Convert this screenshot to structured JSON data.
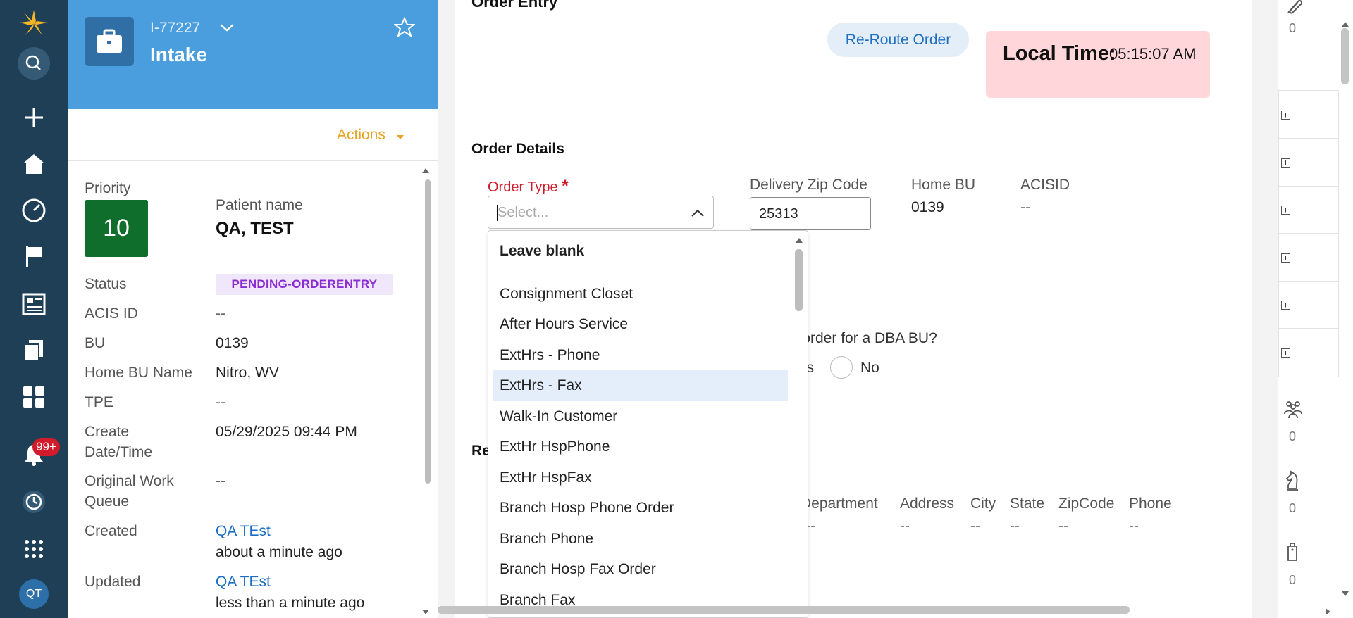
{
  "case": {
    "id": "I-77227",
    "title": "Intake",
    "actions_label": "Actions",
    "priority_label": "Priority",
    "priority_value": "10",
    "patient_name_label": "Patient name",
    "patient_name": "QA, TEST",
    "fields": [
      {
        "label": "Status",
        "value": "PENDING-ORDERENTRY"
      },
      {
        "label": "ACIS ID",
        "value": "--"
      },
      {
        "label": "BU",
        "value": "0139"
      },
      {
        "label": "Home BU Name",
        "value": "Nitro, WV"
      },
      {
        "label": "TPE",
        "value": "--"
      },
      {
        "label": "Create Date/Time",
        "value": "05/29/2025 09:44 PM"
      },
      {
        "label": "Original Work Queue",
        "value": "--"
      },
      {
        "label": "Created",
        "value": "QA TEst",
        "sub": "about a minute ago"
      },
      {
        "label": "Updated",
        "value": "QA TEst",
        "sub": "less than a minute ago"
      }
    ]
  },
  "nav": {
    "notification_badge": "99+",
    "avatar_initials": "QT"
  },
  "main": {
    "section_title": "Order Entry",
    "reroute_label": "Re-Route Order",
    "local_time_label": "Local Time:",
    "local_time_value": "05:15:07 AM",
    "order_details_title": "Order Details",
    "order_type_label": "Order Type",
    "order_type_required": "*",
    "order_type_placeholder": "Select...",
    "delivery_zip_label": "Delivery Zip Code",
    "delivery_zip_value": "25313",
    "home_bu_label": "Home BU",
    "home_bu_value": "0139",
    "acisid_label": "ACISID",
    "acisid_value": "--",
    "dba_question": "s order for a DBA BU?",
    "dba_yes": "es",
    "dba_no": "No",
    "re_title": "Re",
    "table_headers": [
      "Department",
      "Address",
      "City",
      "State",
      "ZipCode",
      "Phone"
    ],
    "table_values": [
      "--",
      "--",
      "--",
      "--",
      "--",
      "--",
      "--"
    ]
  },
  "dropdown": {
    "options": [
      "Leave blank",
      "Consignment Closet",
      "After Hours Service",
      "ExtHrs - Phone",
      "ExtHrs - Fax",
      "Walk-In Customer",
      "ExtHr HspPhone",
      "ExtHr HspFax",
      "Branch Hosp Phone Order",
      "Branch Phone",
      "Branch Hosp Fax Order",
      "Branch Fax"
    ],
    "highlighted": "ExtHrs - Fax"
  },
  "rail": {
    "counts": [
      "0",
      "0",
      "0",
      "0"
    ]
  },
  "colors": {
    "nav_bg": "#1f3f57",
    "header_blue": "#4b9ede",
    "priority_green": "#0f6e2c",
    "status_purple": "#8a2bd4",
    "accent_orange": "#e9a324",
    "link_blue": "#1a6ec2",
    "time_pink": "#ffd7db"
  }
}
